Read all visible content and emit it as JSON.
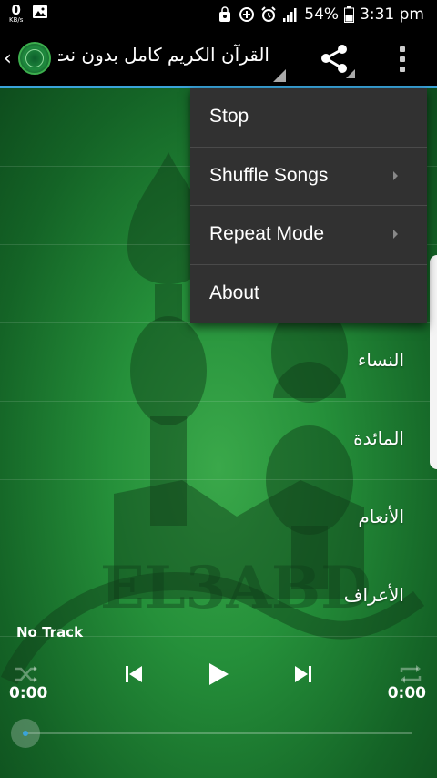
{
  "status_bar": {
    "net_speed_value": "0",
    "net_speed_unit": "KB/s",
    "battery": "54%",
    "time": "3:31 pm"
  },
  "action_bar": {
    "title": "القرآن الكريم كامل بدون نت"
  },
  "popup_menu": {
    "items": [
      {
        "label": "Stop",
        "has_submenu": false
      },
      {
        "label": "Shuffle Songs",
        "has_submenu": true
      },
      {
        "label": "Repeat Mode",
        "has_submenu": true
      },
      {
        "label": "About",
        "has_submenu": false
      }
    ]
  },
  "sura_list": {
    "items": [
      {
        "label": ""
      },
      {
        "label": ""
      },
      {
        "label": ""
      },
      {
        "label": "النساء"
      },
      {
        "label": "المائدة"
      },
      {
        "label": "الأنعام"
      },
      {
        "label": "الأعراف"
      }
    ]
  },
  "player": {
    "now_playing": "No Track",
    "time_elapsed": "0:00",
    "time_total": "0:00",
    "progress": 0
  },
  "watermark_text": "EL3ABD",
  "colors": {
    "accent": "#3aa3d9",
    "background_green": "#25903a",
    "menu_bg": "#313131"
  }
}
